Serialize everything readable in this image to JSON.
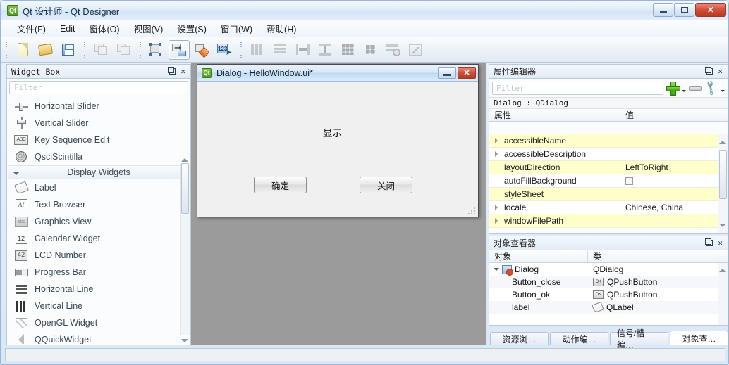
{
  "window": {
    "title": "Qt 设计师 - Qt Designer",
    "icon": "qt-logo-icon",
    "buttons": {
      "minimize": "minimize-icon",
      "maximize": "maximize-icon",
      "close": "✕"
    }
  },
  "menubar": {
    "items": [
      {
        "label": "文件(F)"
      },
      {
        "label": "Edit"
      },
      {
        "label": "窗体(O)"
      },
      {
        "label": "视图(V)"
      },
      {
        "label": "设置(S)"
      },
      {
        "label": "窗口(W)"
      },
      {
        "label": "帮助(H)"
      }
    ]
  },
  "toolbar": {
    "highlight_color": "#ff0000",
    "groups": [
      {
        "buttons": [
          {
            "name": "new-file-button",
            "icon": "new-document-icon",
            "enabled": true,
            "selected": false
          },
          {
            "name": "open-file-button",
            "icon": "open-folder-icon",
            "enabled": true,
            "selected": false
          },
          {
            "name": "save-file-button",
            "icon": "floppy-save-icon",
            "enabled": true,
            "selected": false
          }
        ]
      },
      {
        "buttons": [
          {
            "name": "undo-button",
            "icon": "stacked-windows-icon",
            "enabled": false,
            "selected": false
          },
          {
            "name": "redo-button",
            "icon": "stacked-windows-icon",
            "enabled": false,
            "selected": false
          }
        ]
      },
      {
        "buttons": [
          {
            "name": "edit-widgets-button",
            "icon": "edit-widget-handles-icon",
            "enabled": true,
            "selected": false
          },
          {
            "name": "edit-signals-slots-button",
            "icon": "signal-slot-icon",
            "enabled": true,
            "selected": true,
            "highlighted": true
          },
          {
            "name": "edit-buddies-button",
            "icon": "buddy-diamond-icon",
            "enabled": true,
            "selected": false
          },
          {
            "name": "edit-tab-order-button",
            "icon": "tab-order-123-icon",
            "enabled": true,
            "selected": false
          }
        ]
      },
      {
        "buttons": [
          {
            "name": "layout-horizontally-button",
            "icon": "layout-horizontal-icon",
            "enabled": false,
            "selected": false
          },
          {
            "name": "layout-vertically-button",
            "icon": "layout-vertical-icon",
            "enabled": false,
            "selected": false
          },
          {
            "name": "layout-splitter-horizontal-button",
            "icon": "splitter-horizontal-icon",
            "enabled": false,
            "selected": false
          },
          {
            "name": "layout-splitter-vertical-button",
            "icon": "splitter-vertical-icon",
            "enabled": false,
            "selected": false
          },
          {
            "name": "layout-grid-button",
            "icon": "grid-layout-icon",
            "enabled": false,
            "selected": false
          },
          {
            "name": "layout-form-button",
            "icon": "form-layout-icon",
            "enabled": false,
            "selected": false
          },
          {
            "name": "break-layout-button",
            "icon": "break-layout-icon",
            "enabled": false,
            "selected": false
          },
          {
            "name": "adjust-size-button",
            "icon": "adjust-size-icon",
            "enabled": false,
            "selected": false
          }
        ]
      }
    ]
  },
  "widget_box": {
    "title": "Widget Box",
    "float_icon": "restore-icon",
    "close_icon": "✕",
    "filter_placeholder": "Filter",
    "items": [
      {
        "type": "item",
        "label": "Horizontal Slider",
        "icon": "horizontal-slider-icon"
      },
      {
        "type": "item",
        "label": "Vertical Slider",
        "icon": "vertical-slider-icon"
      },
      {
        "type": "item",
        "label": "Key Sequence Edit",
        "icon": "key-sequence-icon"
      },
      {
        "type": "item",
        "label": "QsciScintilla",
        "icon": "qsci-scintilla-icon"
      },
      {
        "type": "category",
        "label": "Display Widgets",
        "icon": "collapse-triangle-icon"
      },
      {
        "type": "item",
        "label": "Label",
        "icon": "label-icon"
      },
      {
        "type": "item",
        "label": "Text Browser",
        "icon": "text-browser-icon"
      },
      {
        "type": "item",
        "label": "Graphics View",
        "icon": "graphics-view-icon"
      },
      {
        "type": "item",
        "label": "Calendar Widget",
        "icon": "calendar-icon"
      },
      {
        "type": "item",
        "label": "LCD Number",
        "icon": "lcd-number-icon"
      },
      {
        "type": "item",
        "label": "Progress Bar",
        "icon": "progress-bar-icon"
      },
      {
        "type": "item",
        "label": "Horizontal Line",
        "icon": "horizontal-line-icon"
      },
      {
        "type": "item",
        "label": "Vertical Line",
        "icon": "vertical-line-icon"
      },
      {
        "type": "item",
        "label": "OpenGL Widget",
        "icon": "opengl-widget-icon"
      },
      {
        "type": "item",
        "label": "QQuickWidget",
        "icon": "qquickwidget-icon"
      }
    ]
  },
  "design_dialog": {
    "title": "Dialog - HelloWindow.ui*",
    "icon": "qt-logo-icon",
    "minimize": "minimize-icon",
    "close": "✕",
    "label_text": "显示",
    "buttons": [
      {
        "name": "ok-button",
        "label": "确定"
      },
      {
        "name": "close-button",
        "label": "关闭"
      }
    ]
  },
  "property_editor": {
    "title": "属性编辑器",
    "float_icon": "restore-icon",
    "close_icon": "✕",
    "filter_placeholder": "Filter",
    "add_icon": "plus-icon",
    "remove_icon": "minus-icon",
    "config_icon": "wrench-icon",
    "object_line": "Dialog : QDialog",
    "columns": [
      "属性",
      "值"
    ],
    "rows": [
      {
        "name": "accessibleName",
        "value": "",
        "expandable": true,
        "widget": "none"
      },
      {
        "name": "accessibleDescription",
        "value": "",
        "expandable": true,
        "widget": "none"
      },
      {
        "name": "layoutDirection",
        "value": "LeftToRight",
        "expandable": false,
        "widget": "none"
      },
      {
        "name": "autoFillBackground",
        "value": "",
        "expandable": false,
        "widget": "checkbox"
      },
      {
        "name": "styleSheet",
        "value": "",
        "expandable": false,
        "widget": "none"
      },
      {
        "name": "locale",
        "value": "Chinese, China",
        "expandable": true,
        "widget": "none"
      },
      {
        "name": "windowFilePath",
        "value": "",
        "expandable": true,
        "widget": "none"
      }
    ]
  },
  "object_inspector": {
    "title": "对象查看器",
    "float_icon": "restore-icon",
    "close_icon": "✕",
    "columns": [
      "对象",
      "类"
    ],
    "rows": [
      {
        "object": "Dialog",
        "class": "QDialog",
        "icon": "qdialog-icon",
        "expander": true,
        "indent": 0
      },
      {
        "object": "Button_close",
        "class": "QPushButton",
        "icon": "qpushbutton-icon",
        "expander": false,
        "indent": 1
      },
      {
        "object": "Button_ok",
        "class": "QPushButton",
        "icon": "qpushbutton-icon",
        "expander": false,
        "indent": 1
      },
      {
        "object": "label",
        "class": "QLabel",
        "icon": "qlabel-icon",
        "expander": false,
        "indent": 1
      }
    ]
  },
  "bottom_tabs": [
    {
      "label": "资源浏…",
      "active": false
    },
    {
      "label": "动作编…",
      "active": false
    },
    {
      "label": "信号/槽编…",
      "active": false
    },
    {
      "label": "对象查…",
      "active": true
    }
  ]
}
